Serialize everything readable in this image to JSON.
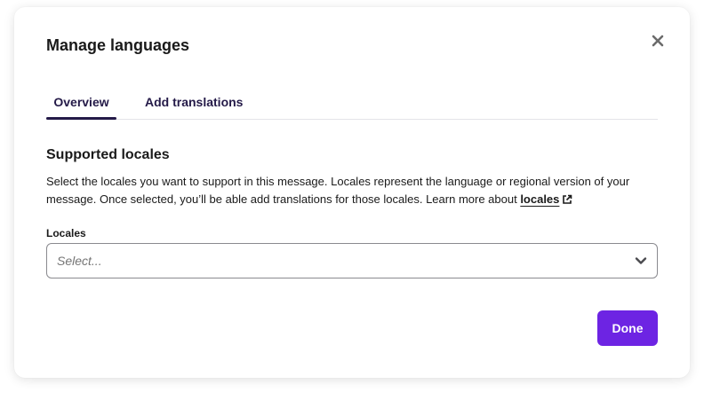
{
  "modal": {
    "title": "Manage languages",
    "close_icon": "close-icon"
  },
  "tabs": [
    {
      "label": "Overview",
      "active": true
    },
    {
      "label": "Add translations",
      "active": false
    }
  ],
  "section": {
    "title": "Supported locales",
    "description": "Select the locales you want to support in this message. Locales represent the language or regional version of your message. Once selected, you’ll be able add translations for those locales. Learn more about ",
    "link_text": "locales",
    "link_icon": "external-link-icon"
  },
  "locales_field": {
    "label": "Locales",
    "placeholder": "Select...",
    "value": "",
    "icon": "chevron-down-icon"
  },
  "footer": {
    "done_label": "Done"
  },
  "colors": {
    "primary": "#6d24e3",
    "tab_text": "#241a48",
    "text": "#1a1a1a"
  }
}
